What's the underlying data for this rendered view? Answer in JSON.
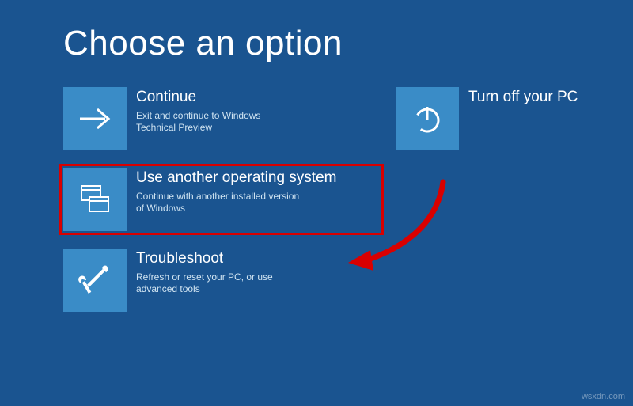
{
  "page": {
    "title": "Choose an option"
  },
  "options": {
    "continue": {
      "title": "Continue",
      "desc": "Exit and continue to Windows Technical Preview"
    },
    "turnoff": {
      "title": "Turn off your PC",
      "desc": ""
    },
    "another_os": {
      "title": "Use another operating system",
      "desc": "Continue with another installed version of Windows"
    },
    "troubleshoot": {
      "title": "Troubleshoot",
      "desc": "Refresh or reset your PC, or use advanced tools"
    }
  },
  "watermark": "wsxdn.com"
}
